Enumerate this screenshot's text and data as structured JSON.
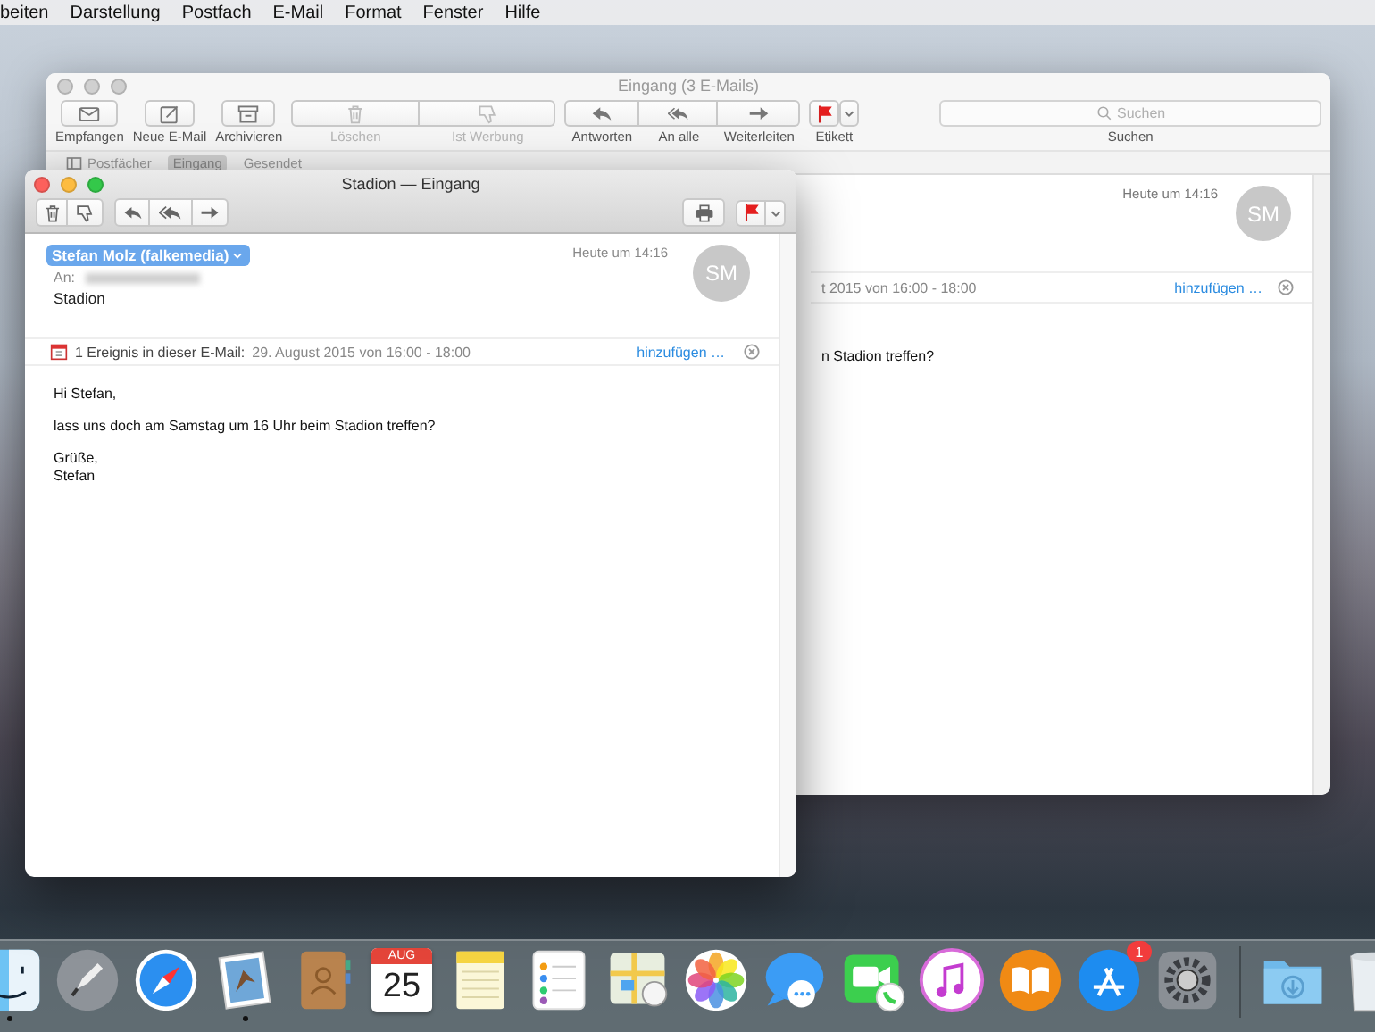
{
  "menubar": {
    "items": [
      "beiten",
      "Darstellung",
      "Postfach",
      "E-Mail",
      "Format",
      "Fenster",
      "Hilfe"
    ]
  },
  "back_window": {
    "title": "Eingang (3 E-Mails)",
    "active": false,
    "toolbar": [
      [
        {
          "kind": "envelope",
          "label": "Empfangen",
          "disabled": false
        }
      ],
      [
        {
          "kind": "compose",
          "label": "Neue E-Mail",
          "disabled": false
        }
      ],
      [
        {
          "kind": "archive",
          "label": "Archivieren",
          "disabled": false
        }
      ],
      [
        {
          "kind": "trash",
          "label": "Löschen",
          "disabled": true
        },
        {
          "kind": "thumbdown",
          "label": "Ist Werbung",
          "disabled": true
        }
      ],
      [
        {
          "kind": "reply",
          "label": "Antworten",
          "disabled": false
        },
        {
          "kind": "reply-all",
          "label": "An alle",
          "disabled": false
        },
        {
          "kind": "forward",
          "label": "Weiterleiten",
          "disabled": false
        }
      ],
      [
        {
          "kind": "flag-menu",
          "label": "Etikett",
          "disabled": false
        }
      ]
    ],
    "search": {
      "placeholder": "Suchen",
      "label": "Suchen"
    },
    "favorites": [
      {
        "label": "Postfächer",
        "selected": false
      },
      {
        "label": "Eingang",
        "selected": true
      },
      {
        "label": "Gesendet",
        "selected": false
      }
    ],
    "message": {
      "date": "Heute um 14:16",
      "avatar": "SM",
      "event_detail": "t 2015 von 16:00 - 18:00",
      "event_link": "hinzufügen …",
      "body": "n Stadion treffen?"
    }
  },
  "front_window": {
    "title": "Stadion — Eingang",
    "active": true,
    "toolbar_left": [
      [
        {
          "kind": "trash"
        },
        {
          "kind": "thumbdown"
        }
      ],
      [
        {
          "kind": "reply"
        },
        {
          "kind": "reply-all"
        },
        {
          "kind": "forward"
        }
      ]
    ],
    "toolbar_right": [
      [
        {
          "kind": "print"
        }
      ],
      [
        {
          "kind": "flag-menu"
        }
      ]
    ],
    "sender": "Stefan Molz (falkemedia)",
    "to_label": "An:",
    "subject": "Stadion",
    "date": "Heute um 14:16",
    "avatar": "SM",
    "event": {
      "count": "1 Ereignis in dieser E-Mail:",
      "detail": "29. August 2015 von 16:00 - 18:00",
      "link": "hinzufügen …"
    },
    "body": [
      "Hi Stefan,",
      "lass uns doch am Samstag um 16 Uhr beim Stadion treffen?",
      "Grüße,\nStefan"
    ]
  },
  "dock": [
    {
      "kind": "finder",
      "running": true
    },
    {
      "kind": "launchpad",
      "running": false
    },
    {
      "kind": "safari",
      "running": false
    },
    {
      "kind": "mail",
      "running": true
    },
    {
      "kind": "contacts",
      "running": false
    },
    {
      "kind": "calendar",
      "running": false,
      "month": "AUG",
      "day": "25"
    },
    {
      "kind": "notes",
      "running": false
    },
    {
      "kind": "reminders",
      "running": false
    },
    {
      "kind": "maps",
      "running": false
    },
    {
      "kind": "photos",
      "running": false
    },
    {
      "kind": "messages",
      "running": false
    },
    {
      "kind": "facetime",
      "running": false
    },
    {
      "kind": "itunes",
      "running": false
    },
    {
      "kind": "ibooks",
      "running": false
    },
    {
      "kind": "appstore",
      "running": false,
      "badge": "1"
    },
    {
      "kind": "preferences",
      "running": false
    },
    {
      "kind": "separator"
    },
    {
      "kind": "downloads",
      "running": false
    },
    {
      "kind": "trash",
      "running": false
    }
  ]
}
